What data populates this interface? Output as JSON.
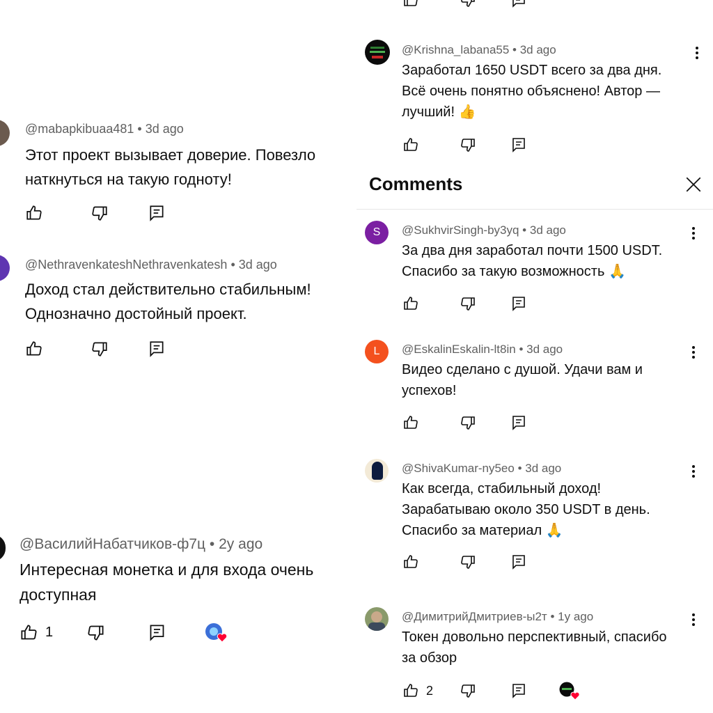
{
  "left_comments": [
    {
      "author": "@mabapkibuaa481",
      "time": "3d ago",
      "lines": [
        "Этот проект вызывает доверие. Повезло",
        "наткнуться на такую годноту!"
      ]
    },
    {
      "author": "@NethravenkateshNethravenkatesh",
      "time": "3d ago",
      "lines": [
        "Доход стал действительно стабильным!",
        "Однозначно достойный проект."
      ]
    },
    {
      "author": "@ВасилийНабатчиков-ф7ц",
      "time": "2y ago",
      "lines": [
        "Интересная монетка и для входа очень",
        "доступная"
      ],
      "likes": "1"
    }
  ],
  "top_right_comment": {
    "author": "@Krishna_labana55",
    "time": "3d ago",
    "lines": [
      "Заработал 1650 USDT всего за два дня.",
      "Всё очень понятно объяснено! Автор —",
      "лучший! 👍"
    ]
  },
  "panel": {
    "title": "Comments",
    "close_icon": "close-icon",
    "comments": [
      {
        "author": "@SukhvirSingh-by3yq",
        "time": "3d ago",
        "avatar_letter": "S",
        "avatar_color": "#7b1fa2",
        "lines": [
          "За два дня заработал почти 1500 USDT.",
          "Спасибо за такую возможность 🙏"
        ]
      },
      {
        "author": "@EskalinEskalin-lt8in",
        "time": "3d ago",
        "avatar_letter": "L",
        "avatar_color": "#f4511e",
        "lines": [
          "Видео сделано с душой. Удачи вам и",
          "успехов!"
        ]
      },
      {
        "author": "@ShivaKumar-ny5eo",
        "time": "3d ago",
        "lines": [
          "Как всегда, стабильный доход!",
          "Зарабатываю около 350 USDT в день.",
          "Спасибо за материал 🙏"
        ]
      },
      {
        "author": "@ДимитрийДмитриев-ы2т",
        "time": "1y ago",
        "lines": [
          "Токен довольно перспективный, спасибо",
          "за обзор"
        ],
        "likes": "2"
      }
    ]
  },
  "icons": {
    "like": "thumbs-up-icon",
    "dislike": "thumbs-down-icon",
    "reply": "reply-icon",
    "more": "more-vert-icon",
    "creator_heart": "creator-heart-icon"
  },
  "colors": {
    "author_gray": "#606060",
    "heart_red": "#ff0033",
    "divider": "#e5e5e5"
  }
}
